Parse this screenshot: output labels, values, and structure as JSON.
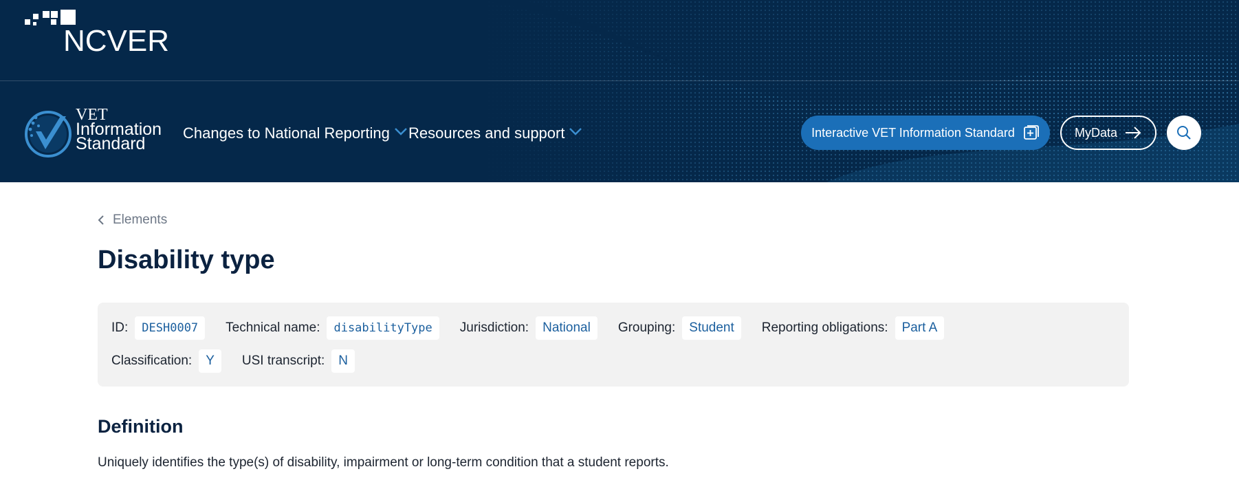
{
  "header": {
    "org_logo_text": "NCVER",
    "standard_logo": {
      "line1": "VET",
      "line2": "Information",
      "line3": "Standard"
    },
    "nav": [
      {
        "label": "Changes to National Reporting"
      },
      {
        "label": "Resources and support"
      }
    ],
    "actions": {
      "interactive_label": "Interactive VET Information Standard",
      "mydata_label": "MyData"
    }
  },
  "breadcrumb": {
    "label": "Elements"
  },
  "page": {
    "title": "Disability type"
  },
  "meta": {
    "row1": [
      {
        "label": "ID:",
        "value": "DESH0007"
      },
      {
        "label": "Technical name:",
        "value": "disabilityType"
      },
      {
        "label": "Jurisdiction:",
        "value": "National"
      },
      {
        "label": "Grouping:",
        "value": "Student"
      },
      {
        "label": "Reporting obligations:",
        "value": "Part A"
      }
    ],
    "row2": [
      {
        "label": "Classification:",
        "value": "Y"
      },
      {
        "label": "USI transcript:",
        "value": "N"
      }
    ]
  },
  "definition": {
    "heading": "Definition",
    "text": "Uniquely identifies the type(s) of disability, impairment or long-term condition that a student reports."
  },
  "colors": {
    "header_bg": "#05284a",
    "accent_blue": "#1b6fb8",
    "meta_value_text": "#1b5f9e",
    "meta_box_bg": "#f2f2f2"
  }
}
